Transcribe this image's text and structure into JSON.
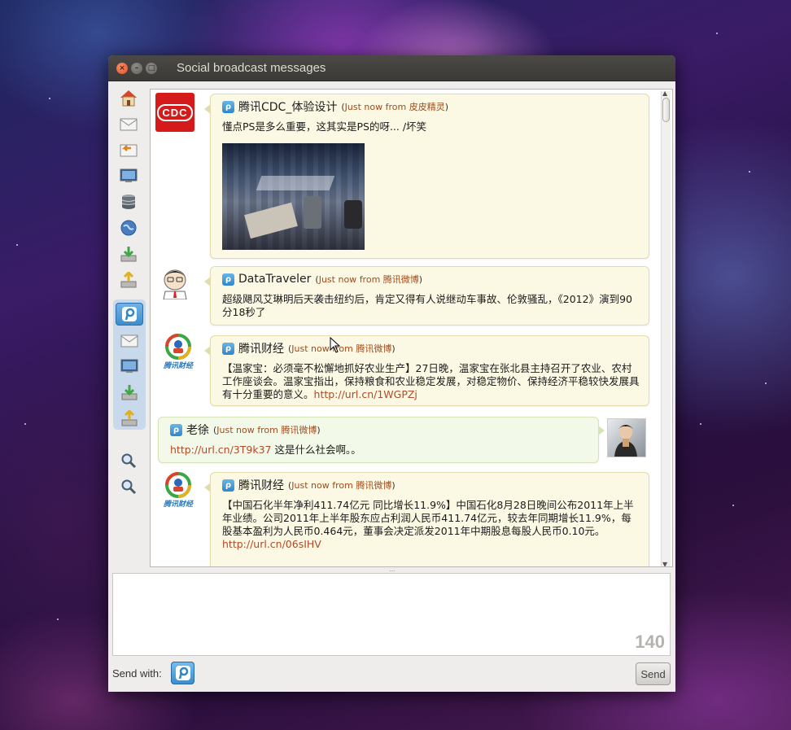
{
  "window": {
    "title": "Social broadcast messages"
  },
  "messages": [
    {
      "user": "腾讯CDC_体验设计",
      "time": "Just now",
      "from_word": "from",
      "source": "皮皮精灵",
      "text": "懂点PS是多么重要，这其实是PS的呀... /坏笑",
      "avatar_text": "CDC"
    },
    {
      "user": "DataTraveler",
      "time": "Just now",
      "from_word": "from",
      "source": "腾讯微博",
      "text": "超级飓风艾琳明后天袭击纽约后，肯定又得有人说继动车事故、伦敦骚乱，《2012》演到90分18秒了"
    },
    {
      "user": "腾讯财经",
      "time": "Just now",
      "from_word": "from",
      "source": "腾讯微博",
      "text": "【温家宝：必须毫不松懈地抓好农业生产】27日晚，温家宝在张北县主持召开了农业、农村工作座谈会。温家宝指出，保持粮食和农业稳定发展，对稳定物价、保持经济平稳较快发展具有十分重要的意义。",
      "link": "http://url.cn/1WGPZj",
      "avatar_text": "腾讯财经"
    },
    {
      "user": "老徐",
      "time": "Just now",
      "from_word": "from",
      "source": "腾讯微博",
      "link": "http://url.cn/3T9k37",
      "text": " 这是什么社会啊。。"
    },
    {
      "user": "腾讯财经",
      "time": "Just now",
      "from_word": "from",
      "source": "腾讯微博",
      "text": "【中国石化半年净利411.74亿元 同比增长11.9%】中国石化8月28日晚间公布2011年上半年业绩。公司2011年上半年股东应占利润人民币411.74亿元，较去年同期增长11.9%，每股基本盈利为人民币0.464元，董事会决定派发2011年中期股息每股人民币0.10元。",
      "link": "http://url.cn/06sIHV",
      "avatar_text": "腾讯财经"
    }
  ],
  "composer": {
    "counter": "140",
    "send_with_label": "Send with:",
    "send_label": "Send"
  }
}
